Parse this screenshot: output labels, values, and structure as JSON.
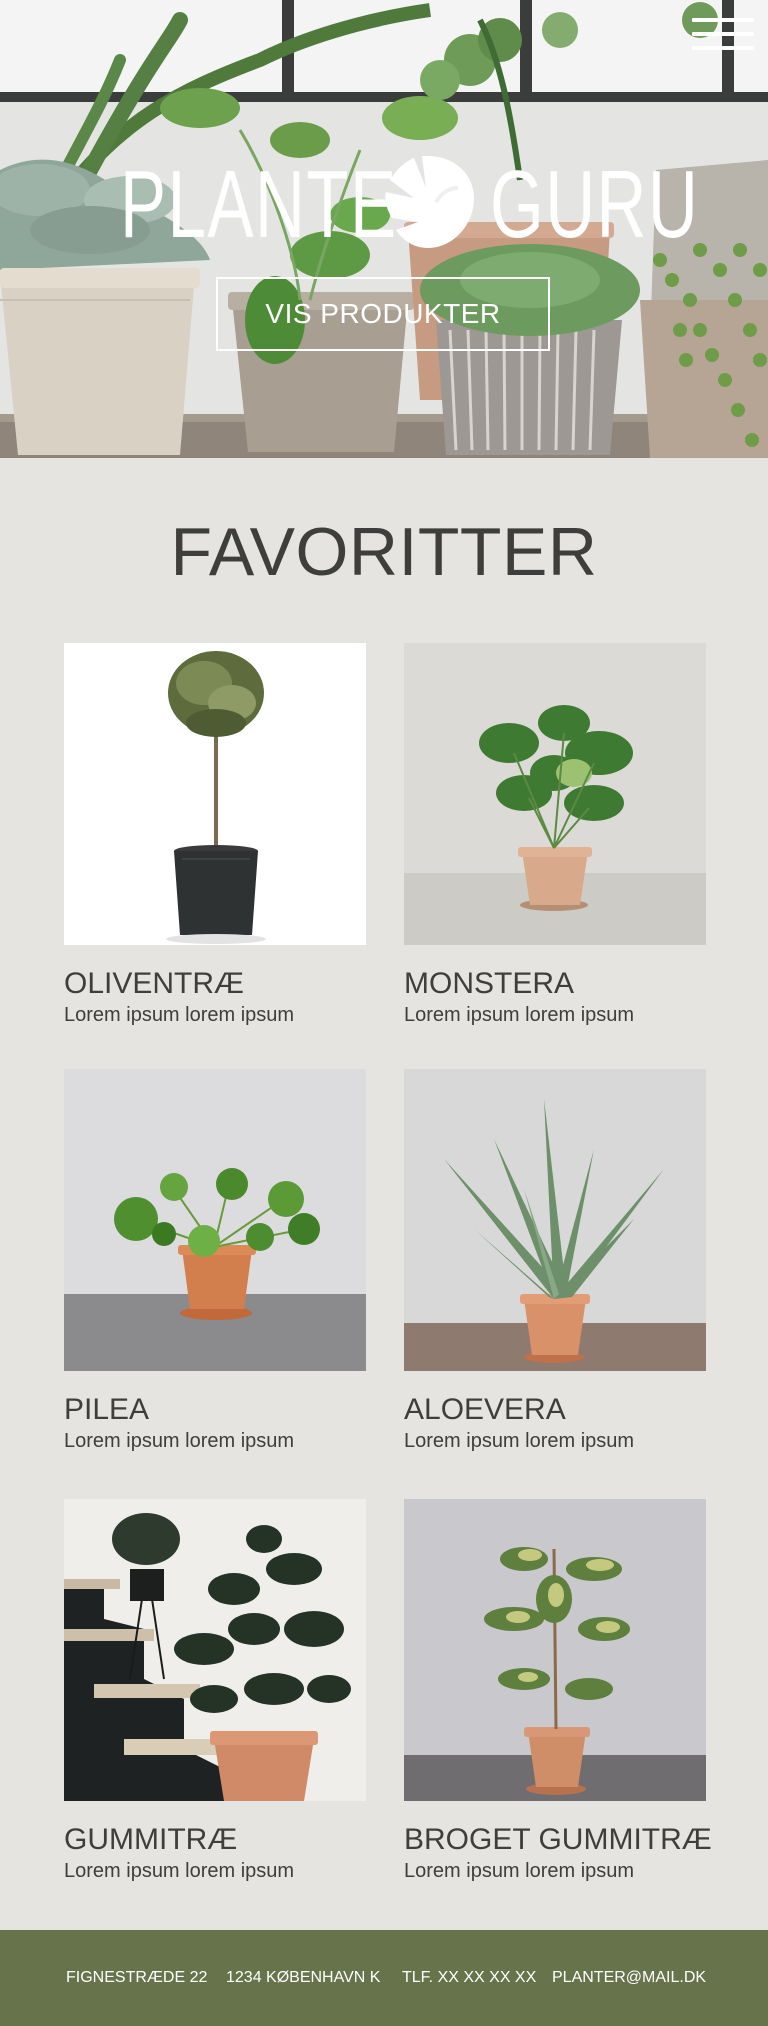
{
  "header": {
    "logo_left": "PLANTE",
    "logo_right": "GURU",
    "cta_label": "VIS PRODUKTER",
    "menu_icon": "hamburger-menu-icon"
  },
  "favorites": {
    "title": "FAVORITTER",
    "items": [
      {
        "name": "OLIVENTRÆ",
        "desc": "Lorem ipsum lorem ipsum"
      },
      {
        "name": "MONSTERA",
        "desc": "Lorem ipsum lorem ipsum"
      },
      {
        "name": "PILEA",
        "desc": "Lorem ipsum lorem ipsum"
      },
      {
        "name": "ALOEVERA",
        "desc": "Lorem ipsum lorem ipsum"
      },
      {
        "name": "GUMMITRÆ",
        "desc": "Lorem ipsum lorem ipsum"
      },
      {
        "name": "BROGET GUMMITRÆ",
        "desc": "Lorem ipsum lorem ipsum"
      }
    ]
  },
  "footer": {
    "address": "FIGNESTRÆDE 22",
    "city": "1234 KØBENHAVN K",
    "phone": "TLF. XX XX XX XX",
    "email": "PLANTER@MAIL.DK"
  },
  "colors": {
    "background": "#e6e4e1",
    "text": "#3e3e3c",
    "footer": "#67734b",
    "logo": "#ffffff"
  }
}
